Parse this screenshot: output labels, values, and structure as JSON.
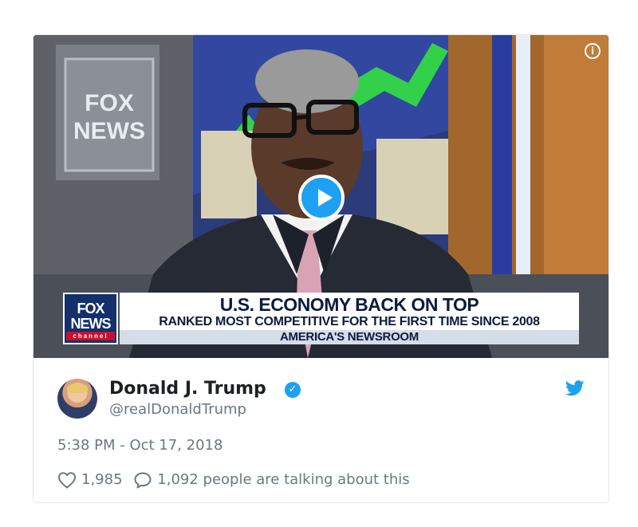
{
  "video": {
    "lower_third": {
      "logo_line1": "FOX",
      "logo_line2": "NEWS",
      "logo_line3": "channel",
      "headline": "U.S. ECONOMY BACK ON TOP",
      "subheadline": "RANKED MOST COMPETITIVE FOR THE FIRST TIME SINCE 2008",
      "show_name": "AMERICA'S NEWSROOM"
    },
    "info_icon": "i"
  },
  "tweet": {
    "author_name": "Donald J. Trump",
    "verified_glyph": "✓",
    "handle": "@realDonaldTrump",
    "timestamp": "5:38 PM - Oct 17, 2018",
    "likes": "1,985",
    "talking": "1,092 people are talking about this"
  },
  "icons": {
    "info": "info-icon",
    "play": "play-icon",
    "verified": "verified-badge-icon",
    "brand": "twitter-bird-icon",
    "like": "heart-icon",
    "reply": "speech-bubble-icon"
  },
  "colors": {
    "accent": "#1da1f2",
    "text": "#1c2022",
    "muted": "#697882",
    "border": "#e1e8ed"
  }
}
